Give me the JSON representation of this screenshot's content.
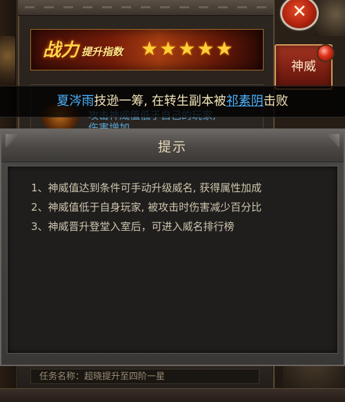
{
  "window": {
    "close_icon": "close-x-icon"
  },
  "power_banner": {
    "title_main": "战力",
    "title_sub": "提升指数",
    "stars": [
      "★",
      "★",
      "★",
      "★",
      "★"
    ],
    "star_color": "#ffcf3a"
  },
  "side_tab": {
    "label": "神威"
  },
  "notice": {
    "player": "夏涔雨",
    "text1": "技逊一筹, 在",
    "place": "转生副本",
    "text2": "被",
    "opponent": "祁素阴",
    "text3": "击败",
    "name_color": "#4fb4ff"
  },
  "background_panel": {
    "line1": "攻击神威值低于自己的玩家,",
    "line2": "伤害增加"
  },
  "dialog": {
    "title": "提示",
    "lines": [
      "1、神威值达到条件可手动升级威名, 获得属性加成",
      "2、神威值低于自身玩家, 被攻击时伤害减少百分比",
      "3、神威晋升登堂入室后，可进入威名排行榜"
    ]
  },
  "task": {
    "label": "任务名称：超晓提升至四阶一星"
  }
}
